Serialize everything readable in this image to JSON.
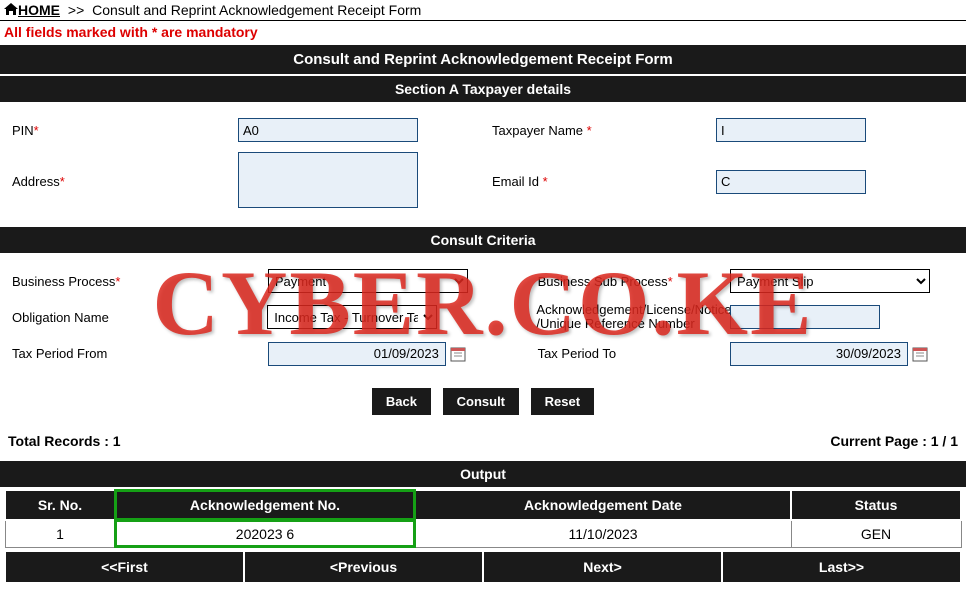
{
  "breadcrumb": {
    "home": "HOME",
    "sep": ">>",
    "current": "Consult and Reprint Acknowledgement Receipt Form"
  },
  "mandatory_note": {
    "prefix": "All fields marked with ",
    "star": "*",
    "suffix": " are mandatory"
  },
  "titles": {
    "main": "Consult and Reprint Acknowledgement Receipt Form",
    "sectionA": "Section A Taxpayer details",
    "consult": "Consult Criteria",
    "output": "Output"
  },
  "labels": {
    "pin": "PIN",
    "taxpayer_name": "Taxpayer Name ",
    "address": "Address",
    "email": "Email Id ",
    "business_process": "Business Process",
    "business_sub_process": "Business Sub Process",
    "obligation_name": "Obligation Name",
    "ack_ref": "Acknowledgement/License/Notice /Unique Reference Number",
    "tax_from": "Tax Period From",
    "tax_to": "Tax Period To"
  },
  "values": {
    "pin": "A0",
    "taxpayer_name": "I",
    "address": "",
    "email": "C",
    "business_process": "Payment",
    "business_sub_process": "Payment Slip",
    "obligation_name": "Income Tax - Turnover Tax",
    "ack_ref": "",
    "tax_from": "01/09/2023",
    "tax_to": "30/09/2023"
  },
  "buttons": {
    "back": "Back",
    "consult": "Consult",
    "reset": "Reset"
  },
  "summary": {
    "total_label": "Total Records : ",
    "total_value": "1",
    "page_label": "Current Page : ",
    "page_value": "1 / 1"
  },
  "output": {
    "headers": {
      "sr": "Sr. No.",
      "ack_no": "Acknowledgement No.",
      "ack_date": "Acknowledgement Date",
      "status": "Status"
    },
    "rows": [
      {
        "sr": "1",
        "ack_no": "202023             6",
        "ack_date": "11/10/2023",
        "status": "GEN"
      }
    ]
  },
  "pager": {
    "first": "<<First",
    "prev": "<Previous",
    "next": "Next>",
    "last": "Last>>"
  },
  "watermark": "CYBER.CO.KE"
}
